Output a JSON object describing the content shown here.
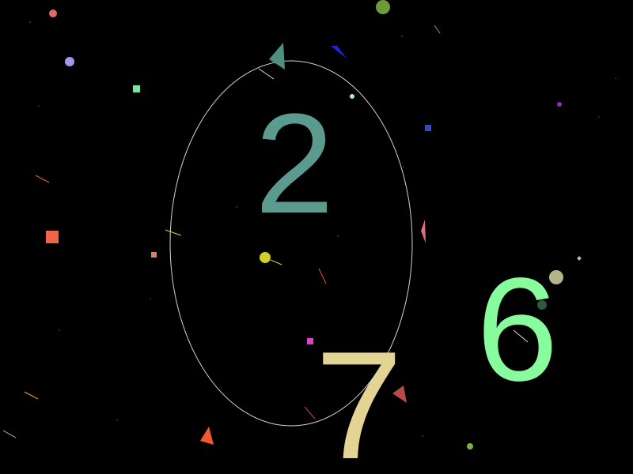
{
  "numbers": [
    {
      "id": "two",
      "text": "2",
      "color": "#5a9a8f"
    },
    {
      "id": "seven",
      "text": "7",
      "color": "#e3d493"
    },
    {
      "id": "six",
      "text": "6",
      "color": "#88fc9c"
    }
  ],
  "colors": {
    "background": "#000000",
    "ring": "#d8d8d8"
  }
}
